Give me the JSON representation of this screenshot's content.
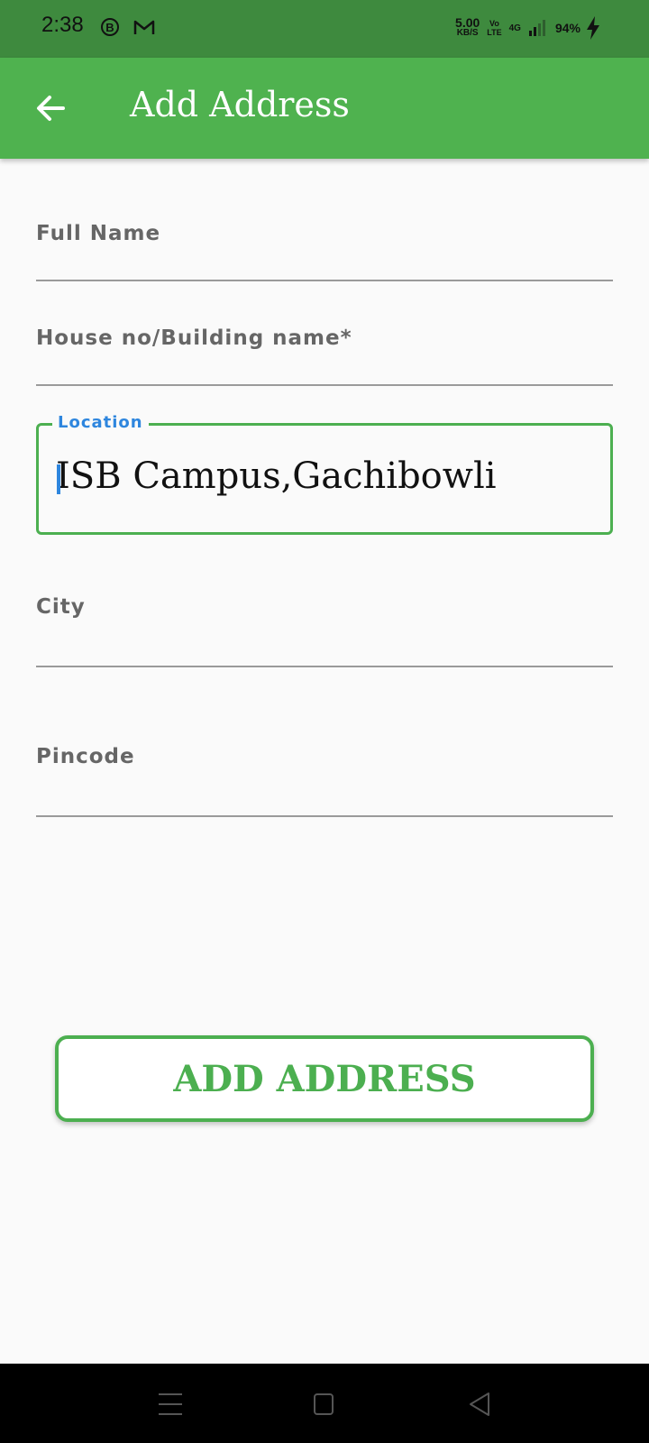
{
  "status_bar": {
    "time": "2:38",
    "notif_b": "B",
    "net_speed_value": "5.00",
    "net_speed_unit": "KB/S",
    "volte_top": "Vo",
    "volte_bottom": "LTE",
    "network": "4G",
    "battery": "94%"
  },
  "app_bar": {
    "title": "Add Address",
    "back_icon": "arrow-left-icon"
  },
  "form": {
    "full_name_label": "Full Name",
    "house_label": "House no/Building name*",
    "location_label": "Location",
    "location_value": "ISB Campus,Gachibowli",
    "city_label": "City",
    "pincode_label": "Pincode"
  },
  "add_button_label": "ADD ADDRESS",
  "colors": {
    "status_bar": "#3e8a3e",
    "app_bar": "#4fb24f",
    "accent_green": "#4caf50",
    "focus_blue": "#2e86de"
  },
  "nav_bar": {
    "icons": [
      "menu-icon",
      "home-square-icon",
      "back-triangle-icon"
    ]
  }
}
